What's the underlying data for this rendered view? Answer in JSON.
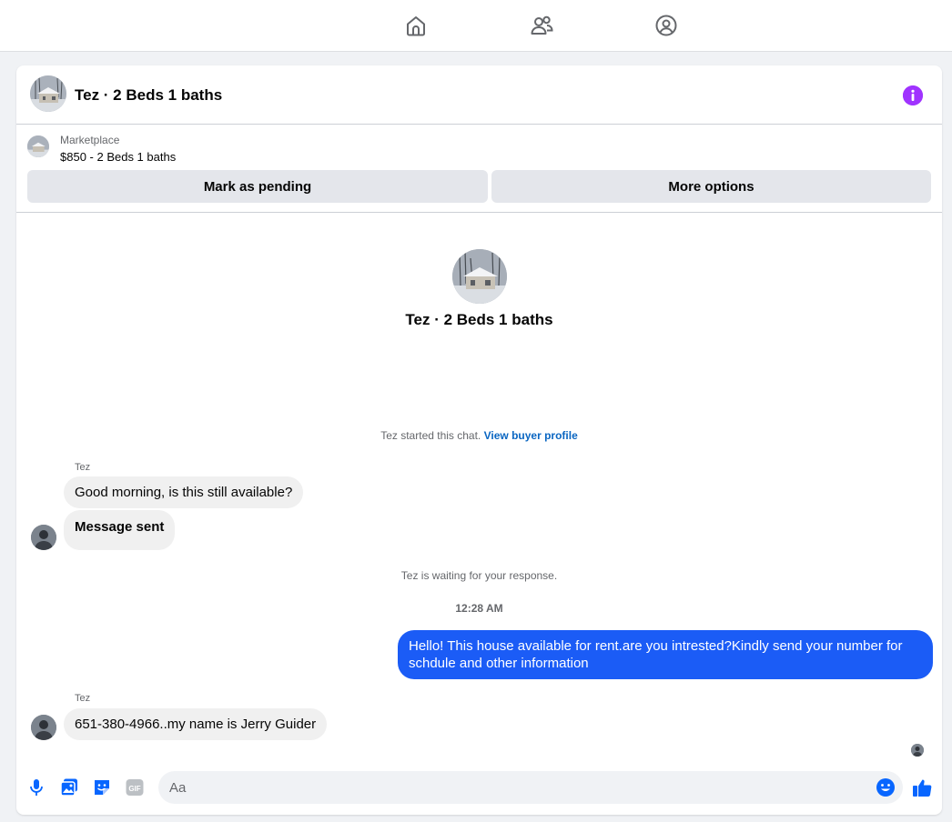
{
  "nav": {
    "items": [
      {
        "icon": "home-icon"
      },
      {
        "icon": "people-icon"
      },
      {
        "icon": "profile-icon"
      }
    ]
  },
  "header": {
    "title": "Tez · 2 Beds 1 baths",
    "info_icon": "info-icon"
  },
  "marketplace": {
    "label": "Marketplace",
    "listing": "$850 - 2 Beds 1 baths",
    "mark_pending_label": "Mark as pending",
    "more_options_label": "More options"
  },
  "conversation": {
    "intro_name": "Tez · 2 Beds 1 baths",
    "started_text": "Tez started this chat.",
    "view_buyer_profile": "View buyer profile",
    "messages": [
      {
        "sender": "Tez",
        "text": "Good morning, is this still available?"
      },
      {
        "sender": "",
        "text": "Message sent"
      }
    ],
    "waiting_text": "Tez is waiting for your response.",
    "timestamp": "12:28 AM",
    "outgoing": "Hello! This house available for rent.are you intrested?Kindly send your number for schdule and other information",
    "reply_sender": "Tez",
    "reply": "651-380-4966..my name is Jerry Guider"
  },
  "composer": {
    "placeholder": "Aa",
    "icons": [
      "microphone-icon",
      "photo-icon",
      "sticker-icon",
      "gif-icon",
      "emoji-icon",
      "thumbs-up-icon"
    ],
    "gif_label": "GIF"
  },
  "colors": {
    "accent": "#0866ff",
    "outgoing_bubble": "#1b5cf6",
    "info": "#a033ff"
  }
}
